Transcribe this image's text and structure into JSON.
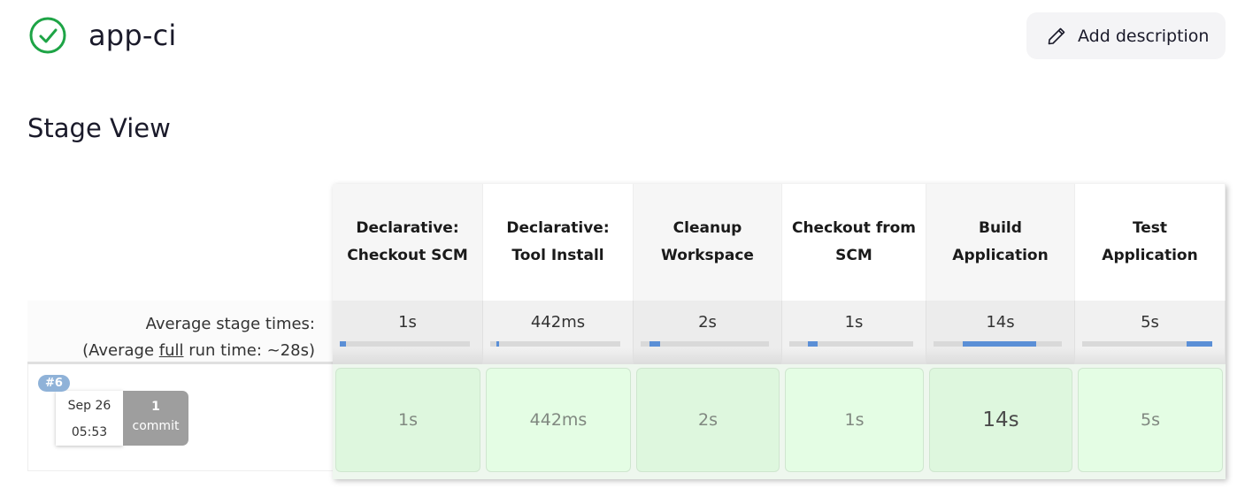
{
  "header": {
    "status_icon": "check-circle-icon",
    "status_color": "#1ea446",
    "job_name": "app-ci",
    "add_description_label": "Add description",
    "add_description_icon": "pencil-icon"
  },
  "section_title": "Stage View",
  "summary": {
    "avg_stage_times_label": "Average stage times:",
    "avg_full_prefix": "(Average ",
    "avg_full_link": "full",
    "avg_full_suffix": " run time: ~28s)"
  },
  "stages": [
    {
      "name": "Declarative: Checkout SCM",
      "avg": "1s",
      "bar_start_pct": 0,
      "bar_width_pct": 5,
      "result": "1s"
    },
    {
      "name": "Declarative: Tool Install",
      "avg": "442ms",
      "bar_start_pct": 5,
      "bar_width_pct": 1.5,
      "result": "442ms"
    },
    {
      "name": "Cleanup Workspace",
      "avg": "2s",
      "bar_start_pct": 7,
      "bar_width_pct": 8,
      "result": "2s"
    },
    {
      "name": "Checkout from SCM",
      "avg": "1s",
      "bar_start_pct": 15,
      "bar_width_pct": 8,
      "result": "1s"
    },
    {
      "name": "Build Application",
      "avg": "14s",
      "bar_start_pct": 23,
      "bar_width_pct": 57,
      "result": "14s"
    },
    {
      "name": "Test Application",
      "avg": "5s",
      "bar_start_pct": 80,
      "bar_width_pct": 20,
      "result": "5s"
    }
  ],
  "run": {
    "build_number": "#6",
    "date": "Sep 26",
    "time": "05:53",
    "commit_count": "1",
    "commit_label": "commit",
    "status_colors": {
      "success_cell": "#e4fde4",
      "success_cell_alt": "#def7de"
    }
  }
}
